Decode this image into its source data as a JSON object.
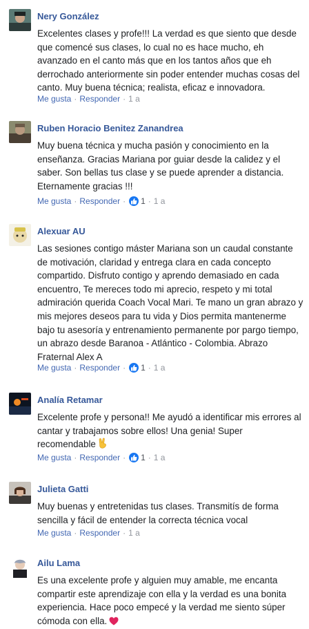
{
  "labels": {
    "like": "Me gusta",
    "reply": "Responder",
    "separator": "·"
  },
  "comments": [
    {
      "author": "Nery González",
      "text": "Excelentes clases y profe!!! La verdad es que siento que desde que comencé sus clases, lo cual no es hace mucho, eh avanzado en el canto más que en los tantos años que eh derrochado anteriormente sin poder entender muchas cosas del canto. Muy buena técnica; realista, eficaz e innovadora.",
      "time": "1 a",
      "likes": ""
    },
    {
      "author": "Ruben Horacio Benitez Zanandrea",
      "text": "Muy buena técnica y mucha pasión y conocimiento en la enseñanza. Gracias Mariana por guiar desde la calidez y el saber. Son bellas tus clase y se puede aprender a distancia. Eternamente gracias !!!",
      "time": "1 a",
      "likes": "1"
    },
    {
      "author": "Alexuar AU",
      "text": "Las sesiones contigo máster Mariana son un caudal constante de motivación, claridad y entrega clara en cada concepto compartido. Disfruto contigo y aprendo demasiado en cada encuentro, Te mereces todo mi aprecio, respeto y mi total admiración querida Coach Vocal Mari. Te mano un gran abrazo y mis mejores deseos para tu vida y Dios permita mantenerme bajo tu asesoría y entrenamiento permanente por pargo tiempo, un abrazo desde Baranoa - Atlántico - Colombia. Abrazo Fraternal Alex A",
      "time": "1 a",
      "likes": "1"
    },
    {
      "author": "Analía Retamar",
      "text": "Excelente profe y persona!! Me ayudó a identificar mis errores al cantar y trabajamos sobre ellos! Una genia! Super recomendable",
      "emoji": "✌️",
      "time": "1 a",
      "likes": "1"
    },
    {
      "author": "Julieta Gatti",
      "text": "Muy buenas y entretenidas tus clases. Transmitís de forma sencilla y fácil de entender la correcta técnica vocal",
      "time": "1 a",
      "likes": ""
    },
    {
      "author": "Ailu Lama",
      "text": "Es una excelente profe y alguien muy amable, me encanta compartir este aprendizaje con ella y la verdad es una bonita experiencia. Hace poco empecé y la verdad me siento súper cómoda con ella.",
      "emoji": "❤️",
      "time": "",
      "likes": ""
    }
  ],
  "colors": {
    "author": "#365899",
    "link": "#4267b2",
    "like_badge": "#1877f2",
    "heart": "#e0245e"
  }
}
